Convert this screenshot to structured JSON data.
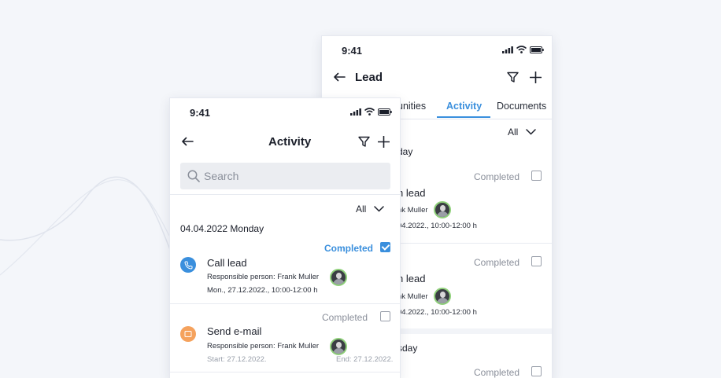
{
  "back_screen": {
    "status_time": "9:41",
    "title": "Lead",
    "tabs": [
      {
        "label": "unities",
        "active": false
      },
      {
        "label": "Activity",
        "active": true
      },
      {
        "label": "Documents",
        "active": false
      }
    ],
    "filter_label": "All",
    "fragments": {
      "day_1": "day",
      "item_1_status": "Completed",
      "item_1_title": "h lead",
      "item_1_person": "nk Muller",
      "item_1_time": "04.2022., 10:00-12:00 h",
      "item_2_status": "Completed",
      "item_2_title": "h lead",
      "item_2_person": "nk Muller",
      "item_2_time": "04.2022., 10:00-12:00 h",
      "day_2": "sday",
      "item_3_status": "Completed"
    }
  },
  "front_screen": {
    "status_time": "9:41",
    "title": "Activity",
    "search_placeholder": "Search",
    "filter_label": "All",
    "date_header": "04.04.2022 Monday",
    "activities": [
      {
        "status": "Completed",
        "completed": true,
        "icon": "phone-icon",
        "icon_color": "#3a8fdd",
        "title": "Call lead",
        "responsible": "Responsible person: Frank Muller",
        "time": "Mon., 27.12.2022., 10:00-12:00 h"
      },
      {
        "status": "Completed",
        "completed": false,
        "icon": "email-icon",
        "icon_color": "#f5a25d",
        "title": "Send e-mail",
        "responsible": "Responsible person: Frank Muller",
        "start": "Start: 27.12.2022.",
        "end": "End: 27.12.2022."
      }
    ]
  },
  "colors": {
    "accent": "#3a8fdd",
    "email_accent": "#f5a25d",
    "avatar_ring": "#8fd07a",
    "background": "#f4f6fa"
  }
}
